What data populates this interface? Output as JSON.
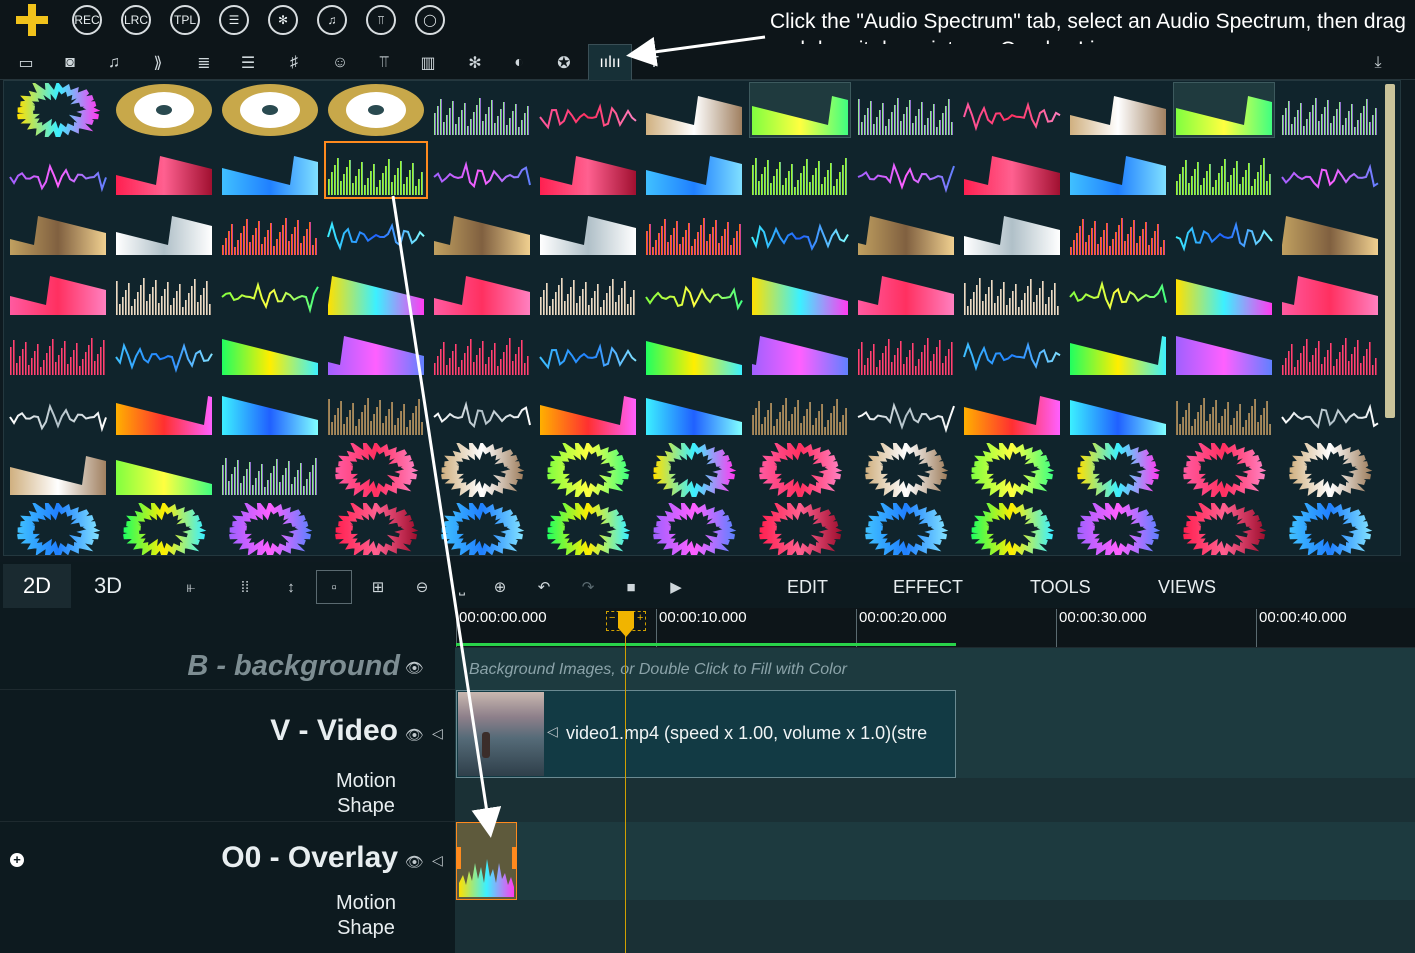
{
  "top_buttons": [
    "REC",
    "LRC",
    "TPL"
  ],
  "instruction": "Click the \"Audio Spectrum\" tab, select an Audio Spectrum, then drag and drop it down into an Overlay Line.",
  "timeline_tabs": [
    "2D",
    "3D"
  ],
  "menus": [
    "EDIT",
    "EFFECT",
    "TOOLS",
    "VIEWS"
  ],
  "ruler": [
    "00:00:00.000",
    "00:00:10.000",
    "00:00:20.000",
    "00:00:30.000",
    "00:00:40.000"
  ],
  "tracks": {
    "background": {
      "label": "B - background",
      "hint": "Background Images, or Double Click to Fill with Color"
    },
    "video": {
      "label": "V - Video",
      "sub1": "Motion",
      "sub2": "Shape",
      "clip": "video1.mp4  (speed x 1.00, volume x 1.0)(stre"
    },
    "overlay": {
      "label": "O0 - Overlay",
      "sub1": "Motion",
      "sub2": "Shape"
    }
  },
  "colors": {
    "accent": "#ff8a1e",
    "playhead": "#d0a000",
    "progress": "#29d34a",
    "plus": "#f1c21b"
  }
}
